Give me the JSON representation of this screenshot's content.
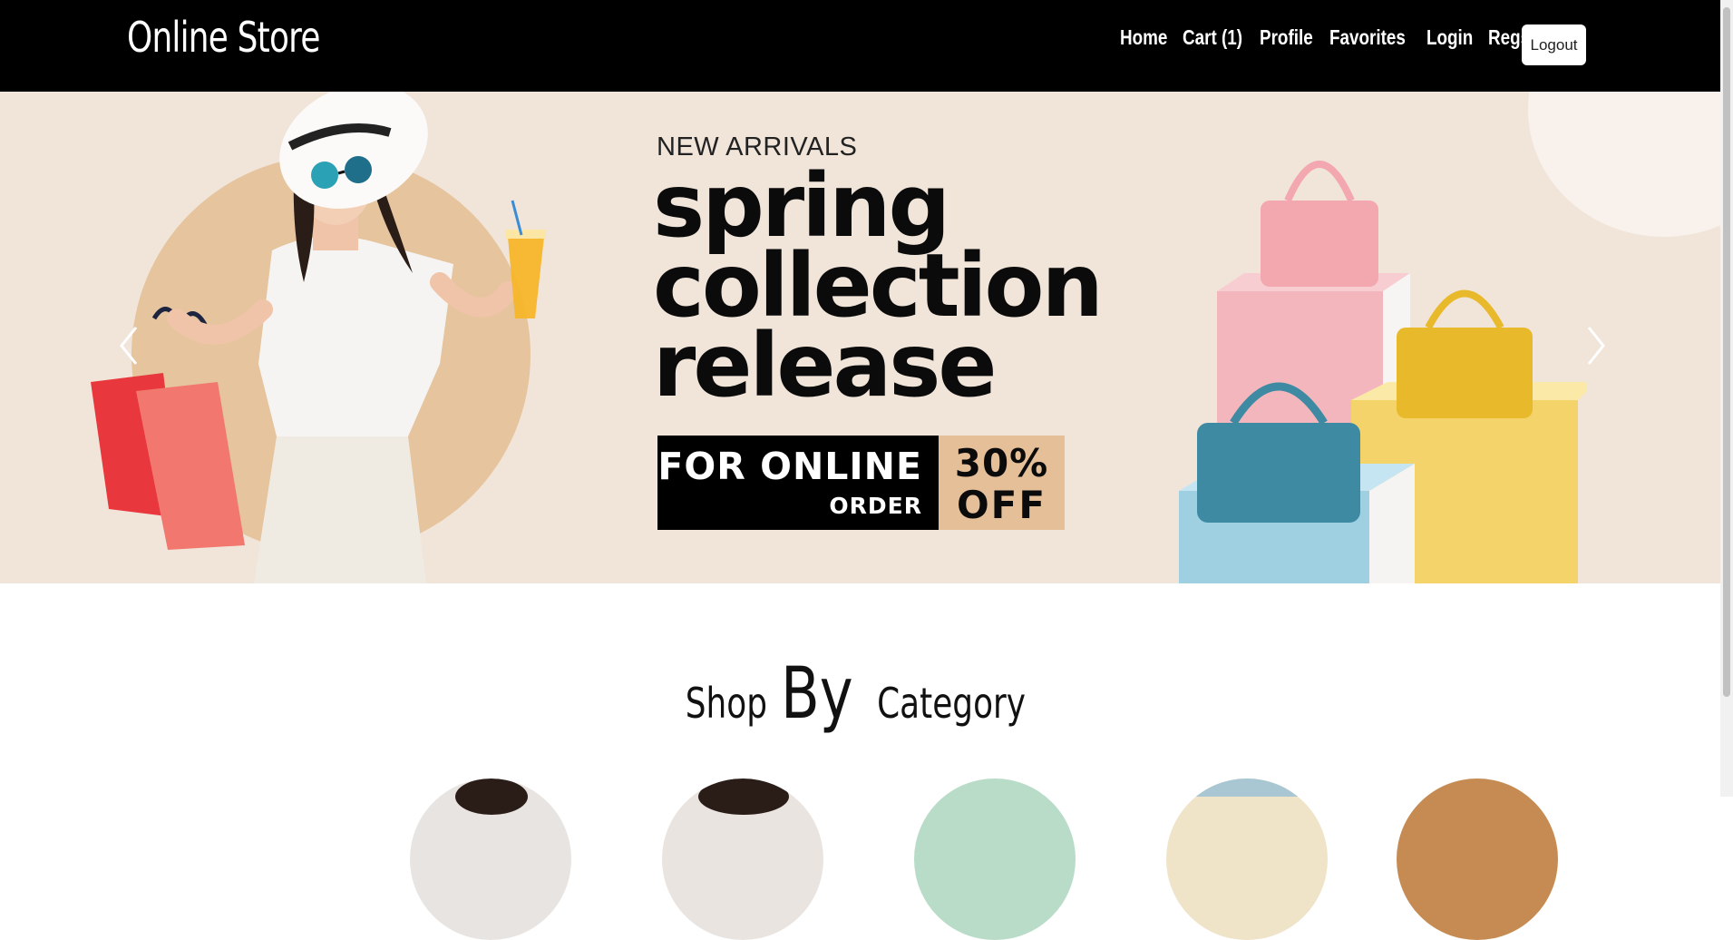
{
  "brand": "Online Store",
  "nav": {
    "links": [
      "Home",
      "Cart (1)",
      "Profile",
      "Favorites",
      "Login",
      "Regsiter"
    ],
    "logout": "Logout"
  },
  "hero": {
    "eyebrow": "NEW ARRIVALS",
    "headline": [
      "spring",
      "collection",
      "release"
    ],
    "promo_line1": "FOR ONLINE",
    "promo_line2": "ORDER",
    "discount_line1": "30%",
    "discount_line2": "OFF",
    "colors": {
      "background": "#f1e5da",
      "accent": "#e4bf98",
      "dark": "#000000"
    }
  },
  "categories": {
    "heading_part1": "Shop",
    "heading_part2": "By",
    "heading_part3": "Category",
    "circle_colors": [
      "#e8e4e2",
      "#e9e4e0",
      "#b8dcc8",
      "#efe3c8",
      "#c58b52"
    ]
  }
}
